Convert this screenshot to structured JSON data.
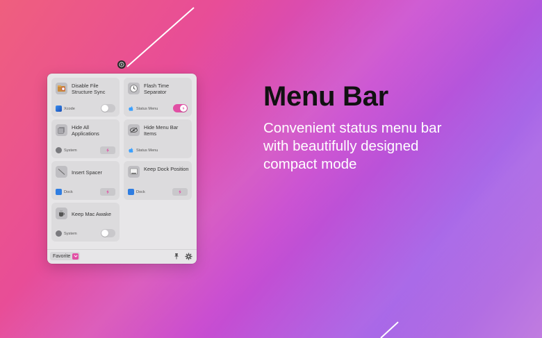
{
  "heading": "Menu Bar",
  "subheading": {
    "line1": "Convenient status menu bar",
    "line2": "with beautifully designed",
    "line3": "compact mode"
  },
  "menu": {
    "status_icon": "power-bolt-icon",
    "items": [
      {
        "title": "Disable File Structure Sync",
        "source": "Xcode",
        "source_icon": "xcode-icon",
        "control": "toggle",
        "on": false
      },
      {
        "title": "Flash Time Separator",
        "source": "Status Menu",
        "source_icon": "apple-icon",
        "control": "toggle",
        "on": true
      },
      {
        "title": "Hide All Applications",
        "source": "System",
        "source_icon": "system-icon",
        "control": "run"
      },
      {
        "title": "Hide Menu Bar Items",
        "source": "Status Menu",
        "source_icon": "apple-icon",
        "control": "run"
      },
      {
        "title": "Insert Spacer",
        "source": "Dock",
        "source_icon": "dock-icon",
        "control": "run"
      },
      {
        "title": "Keep Dock Position",
        "source": "Dock",
        "source_icon": "dock-icon",
        "control": "run"
      },
      {
        "title": "Keep Mac Awake",
        "source": "System",
        "source_icon": "system-icon",
        "control": "toggle",
        "on": false
      }
    ],
    "footer": {
      "filter_label": "Favorite",
      "pin_icon": "pin-icon",
      "settings_icon": "gear-icon"
    }
  },
  "colors": {
    "accent": "#e14fa4",
    "panel": "#e7e6e8",
    "card": "#dcdbdd"
  }
}
